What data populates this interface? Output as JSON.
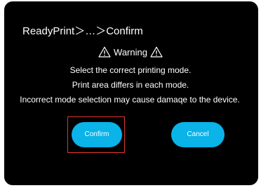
{
  "dialog": {
    "breadcrumb": "ReadyPrint＞…＞Confirm",
    "warning_label": "Warning",
    "messages": [
      "Select the correct printing mode.",
      "Print area differs in each mode.",
      "Incorrect mode selection may cause damaqe to the device."
    ],
    "confirm_label": "Confirm",
    "cancel_label": "Cancel"
  },
  "colors": {
    "background": "#000000",
    "button": "#0ab3e8",
    "highlight_outline": "#e0352b",
    "text": "#ffffff"
  },
  "icons": {
    "warning": "warning-triangle-icon"
  }
}
